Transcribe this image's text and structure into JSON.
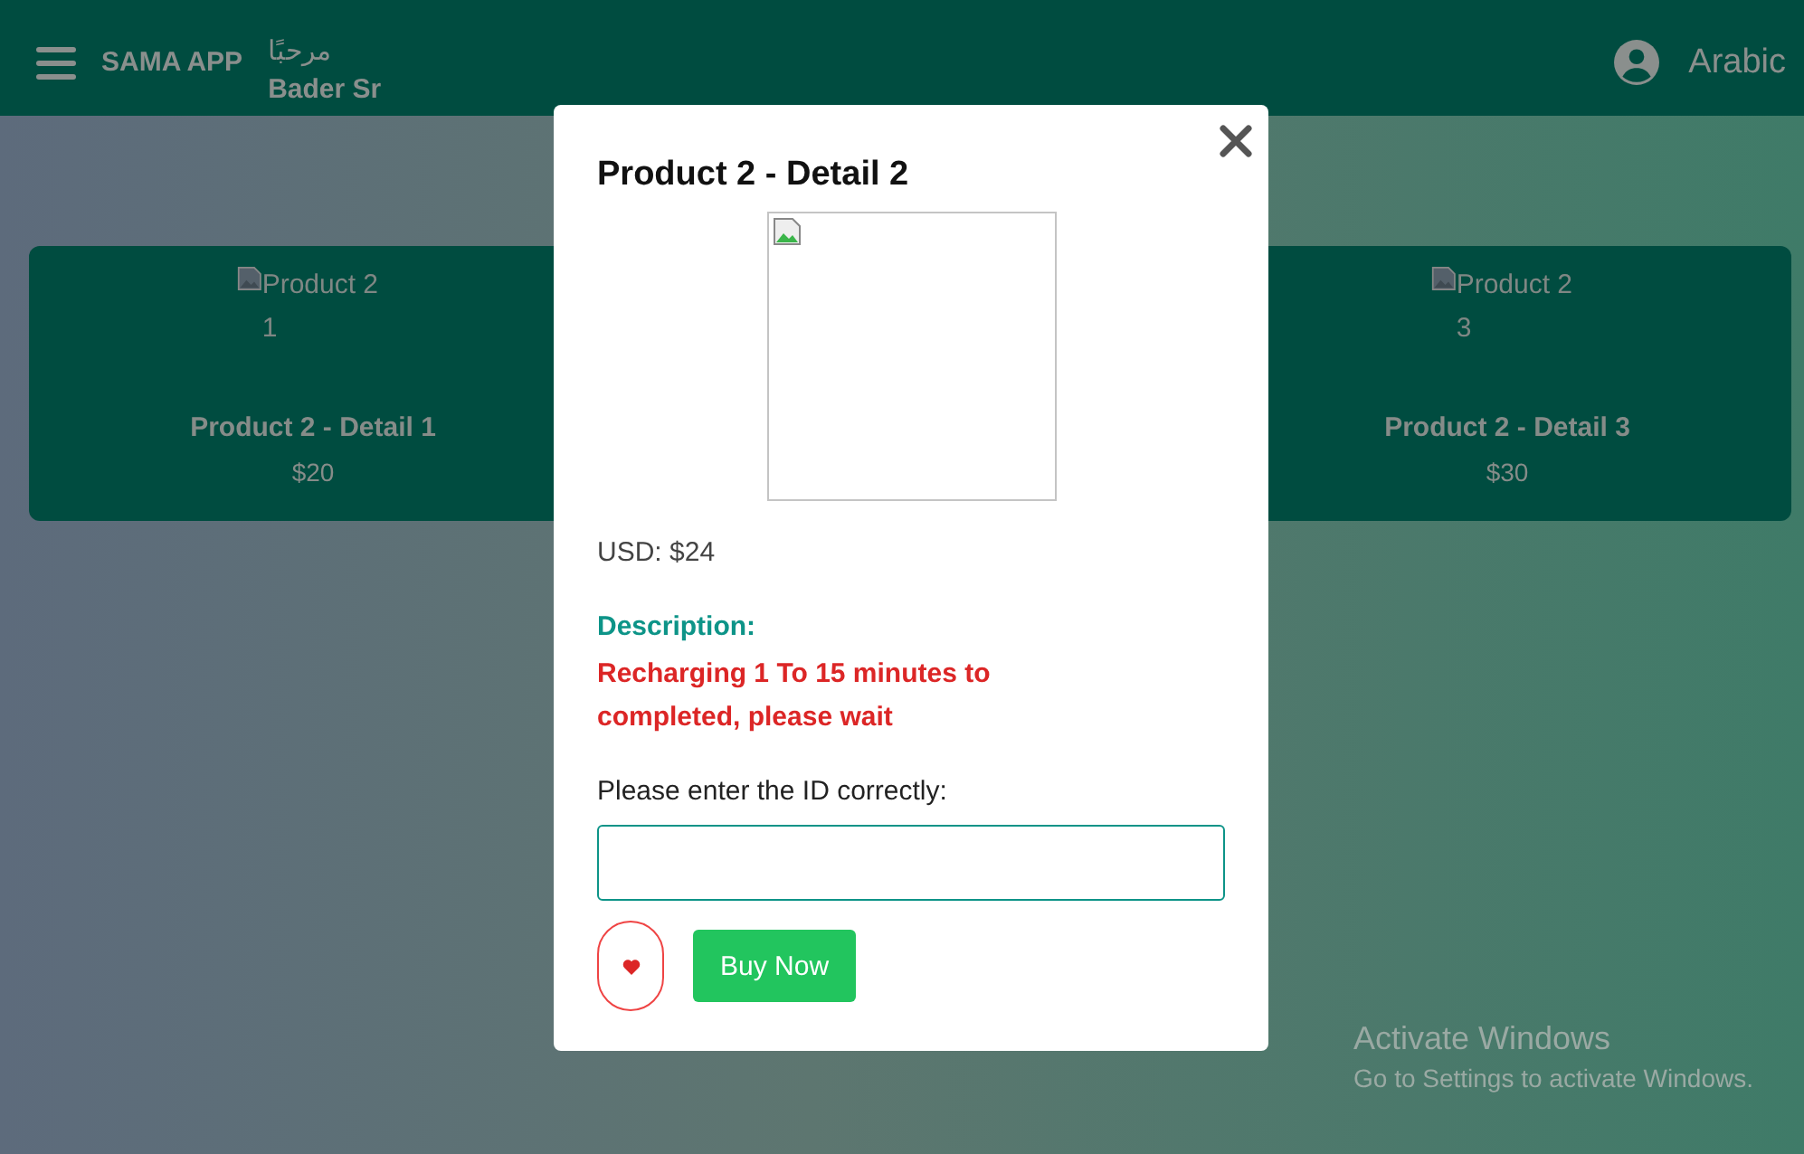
{
  "header": {
    "app_name": "SAMA APP",
    "greeting": "مرحبًا",
    "user_name": "Bader Sr",
    "language": "Arabic"
  },
  "products": [
    {
      "image_alt": "Product 2 1",
      "name": "Product 2 - Detail 1",
      "price": "$20"
    },
    {
      "image_alt": "Product 2 3",
      "name": "Product 2 - Detail 3",
      "price": "$30"
    }
  ],
  "modal": {
    "title": "Product 2 - Detail 2",
    "price": "USD: $24",
    "description_label": "Description:",
    "description": "Recharging 1 To 15 minutes to completed, please wait",
    "id_label": "Please enter the ID correctly:",
    "buy_button": "Buy Now"
  },
  "windows_notice": {
    "title": "Activate Windows",
    "subtitle": "Go to Settings to activate Windows."
  }
}
